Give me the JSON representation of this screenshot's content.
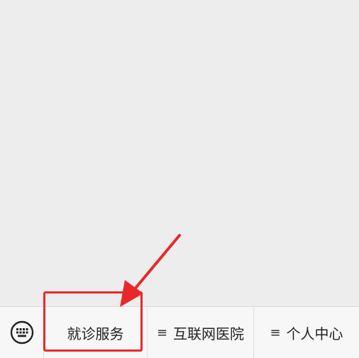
{
  "menu": {
    "keyboard_icon": "keyboard-icon",
    "items": [
      {
        "label": "就诊服务",
        "has_submenu_icon": false
      },
      {
        "label": "互联网医院",
        "has_submenu_icon": true
      },
      {
        "label": "个人中心",
        "has_submenu_icon": true
      }
    ],
    "submenu_glyph": "≡"
  },
  "annotation": {
    "color": "#e8282a",
    "target": "menu.items.0"
  }
}
